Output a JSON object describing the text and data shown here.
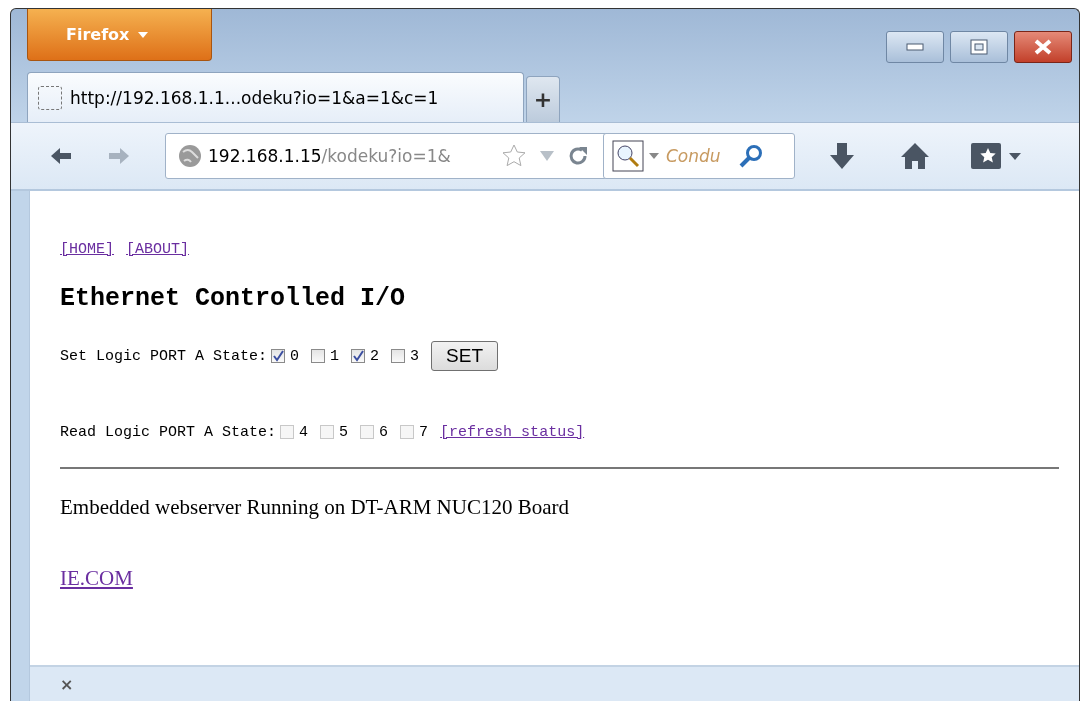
{
  "window": {
    "app_button": "Firefox",
    "tab": {
      "title": "http://192.168.1.1...odeku?io=1&a=1&c=1",
      "selected": true
    },
    "new_tab": "+"
  },
  "navbar": {
    "url_host": "192.168.1.15",
    "url_path": "/kodeku?io=1&",
    "search_placeholder": "Condu"
  },
  "page": {
    "nav_links": [
      "[HOME]",
      "[ABOUT]"
    ],
    "heading": "Ethernet Controlled I/O",
    "rows": [
      {
        "label": "Set Logic PORT A State:",
        "checkboxes": [
          {
            "label": "0",
            "checked": true,
            "disabled": false
          },
          {
            "label": "1",
            "checked": false,
            "disabled": false
          },
          {
            "label": "2",
            "checked": true,
            "disabled": false
          },
          {
            "label": "3",
            "checked": false,
            "disabled": false
          }
        ],
        "button": "SET"
      },
      {
        "label": "Read Logic PORT A State:",
        "checkboxes": [
          {
            "label": "4",
            "checked": false,
            "disabled": true
          },
          {
            "label": "5",
            "checked": false,
            "disabled": true
          },
          {
            "label": "6",
            "checked": false,
            "disabled": true
          },
          {
            "label": "7",
            "checked": false,
            "disabled": true
          }
        ],
        "link": "[refresh status]"
      }
    ],
    "footer_text": "Embedded webserver Running on DT-ARM NUC120 Board",
    "footer_link": "IE.COM"
  },
  "status_bar": {
    "close": "×"
  }
}
